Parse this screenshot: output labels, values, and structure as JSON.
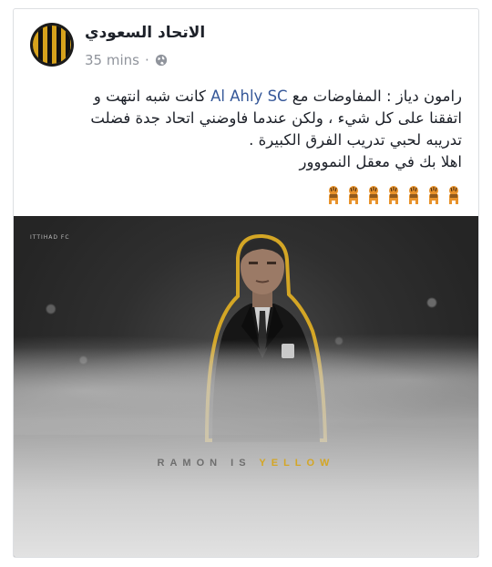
{
  "post": {
    "author": "الاتحاد السعودي",
    "time": "35 mins",
    "separator": "·",
    "privacy_icon": "globe-icon",
    "text_lines": [
      {
        "before": "رامون دياز : المفاوضات مع ",
        "mention": "Al Ahly SC",
        "after": " كانت شبه انتهت و"
      },
      {
        "text": "اتفقنا على كل شيء ، ولكن عندما فاوضني اتحاد جدة فضلت"
      },
      {
        "text": "تدريبه لحبي تدريب الفرق الكبيرة ."
      },
      {
        "text": "اهلا بك في معقل النمووور"
      }
    ],
    "emoji_icon": "tiger-emoji-icon",
    "emoji_count": 7
  },
  "photo": {
    "tagline_part1": "RAMON IS",
    "tagline_part2": "YELLOW",
    "brand_small": "ITTIHAD FC"
  },
  "colors": {
    "link": "#365899",
    "club_yellow": "#d4a625",
    "meta_gray": "#90949c"
  }
}
